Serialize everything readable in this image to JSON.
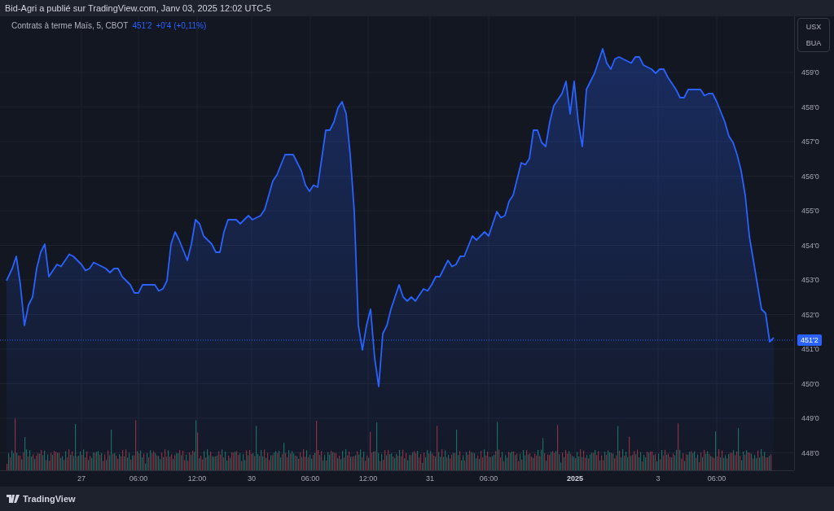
{
  "header": {
    "text": "Bid-Agri a publié sur TradingView.com, Janv 03, 2025 12:02 UTC-5"
  },
  "chart": {
    "legend": {
      "symbol": "Contrats à terme Maïs, 5, CBOT",
      "price": "451'2",
      "change": "+0'4 (+0,11%)"
    },
    "currency_units": [
      "USX",
      "BUA"
    ],
    "price_axis_labels": [
      "459'0",
      "458'0",
      "457'0",
      "456'0",
      "455'0",
      "454'0",
      "453'0",
      "452'0",
      "451'0",
      "450'0",
      "449'0",
      "448'0"
    ],
    "last_price_badge": "451'2",
    "time_axis_labels": [
      {
        "label": "27",
        "bold": false
      },
      {
        "label": "06:00",
        "bold": false
      },
      {
        "label": "12:00",
        "bold": false
      },
      {
        "label": "30",
        "bold": false
      },
      {
        "label": "06:00",
        "bold": false
      },
      {
        "label": "12:00",
        "bold": false
      },
      {
        "label": "31",
        "bold": false
      },
      {
        "label": "06:00",
        "bold": false
      },
      {
        "label": "2025",
        "bold": true
      },
      {
        "label": "3",
        "bold": false
      },
      {
        "label": "06:00",
        "bold": false
      }
    ]
  },
  "footer": {
    "logo_text": "TradingView"
  }
}
